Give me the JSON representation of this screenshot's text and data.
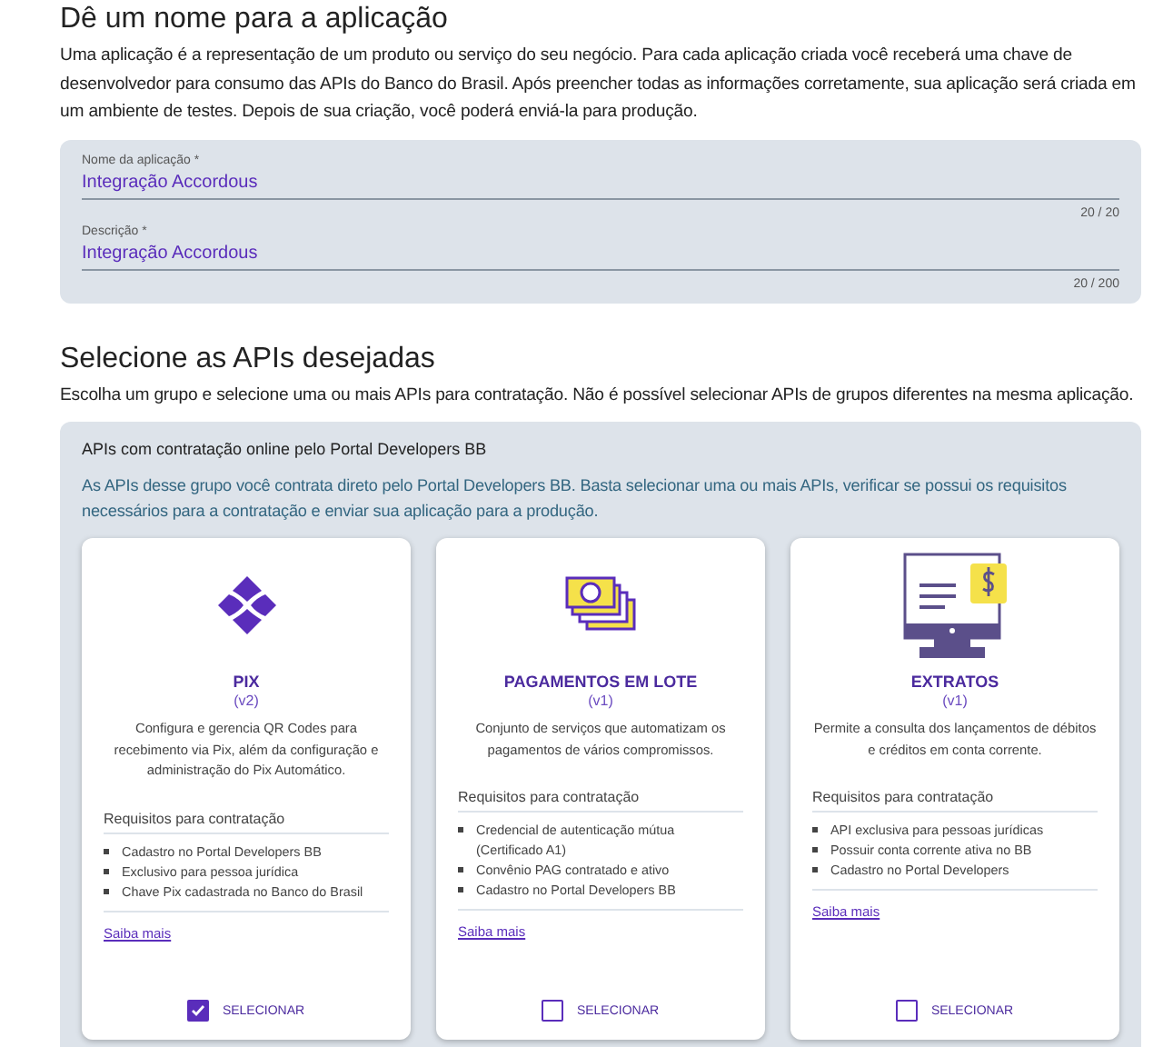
{
  "app_section": {
    "title": "Dê um nome para a aplicação",
    "description": "Uma aplicação é a representação de um produto ou serviço do seu negócio. Para cada aplicação criada você receberá uma chave de desenvolvedor para consumo das APIs do Banco do Brasil. Após preencher todas as informações corretamente, sua aplicação será criada em um ambiente de testes. Depois de sua criação, você poderá enviá-la para produção.",
    "fields": [
      {
        "label": "Nome da aplicação *",
        "value": "Integração Accordous",
        "counter": "20 / 20"
      },
      {
        "label": "Descrição *",
        "value": "Integração Accordous",
        "counter": "20 / 200"
      }
    ]
  },
  "apis_section": {
    "title": "Selecione as APIs desejadas",
    "description": "Escolha um grupo e selecione uma ou mais APIs para contratação. Não é possível selecionar APIs de grupos diferentes na mesma aplicação.",
    "group": {
      "title": "APIs com contratação online pelo Portal Developers BB",
      "description": "As APIs desse grupo você contrata direto pelo Portal Developers BB. Basta selecionar uma ou mais APIs, verificar se possui os requisitos necessários para a contratação e enviar sua aplicação para a produção.",
      "cards": [
        {
          "kind": "pix",
          "name": "PIX",
          "version": "(v2)",
          "description": "Configura e gerencia QR Codes para recebimento via Pix, além da configuração e administração do Pix Automático.",
          "requirements_title": "Requisitos para contratação",
          "requirements": [
            "Cadastro no Portal Developers BB",
            "Exclusivo para pessoa jurídica",
            "Chave Pix cadastrada no Banco do Brasil"
          ],
          "link": "Saiba mais",
          "select_label": "SELECIONAR",
          "selected": true
        },
        {
          "kind": "payments",
          "name": "PAGAMENTOS EM LOTE",
          "version": "(v1)",
          "description": "Conjunto de serviços que automatizam os pagamentos de vários compromissos.",
          "requirements_title": "Requisitos para contratação",
          "requirements": [
            "Credencial de autenticação mútua (Certificado A1)",
            "Convênio PAG contratado e ativo",
            "Cadastro no Portal Developers BB"
          ],
          "link": "Saiba mais",
          "select_label": "SELECIONAR",
          "selected": false
        },
        {
          "kind": "statements",
          "name": "EXTRATOS",
          "version": "(v1)",
          "description": "Permite a consulta dos lançamentos de débitos e créditos em conta corrente.",
          "requirements_title": "Requisitos para contratação",
          "requirements": [
            "API exclusiva para pessoas jurídicas",
            "Possuir conta corrente ativa no BB",
            "Cadastro no Portal Developers"
          ],
          "link": "Saiba mais",
          "select_label": "SELECIONAR",
          "selected": false
        }
      ]
    }
  }
}
